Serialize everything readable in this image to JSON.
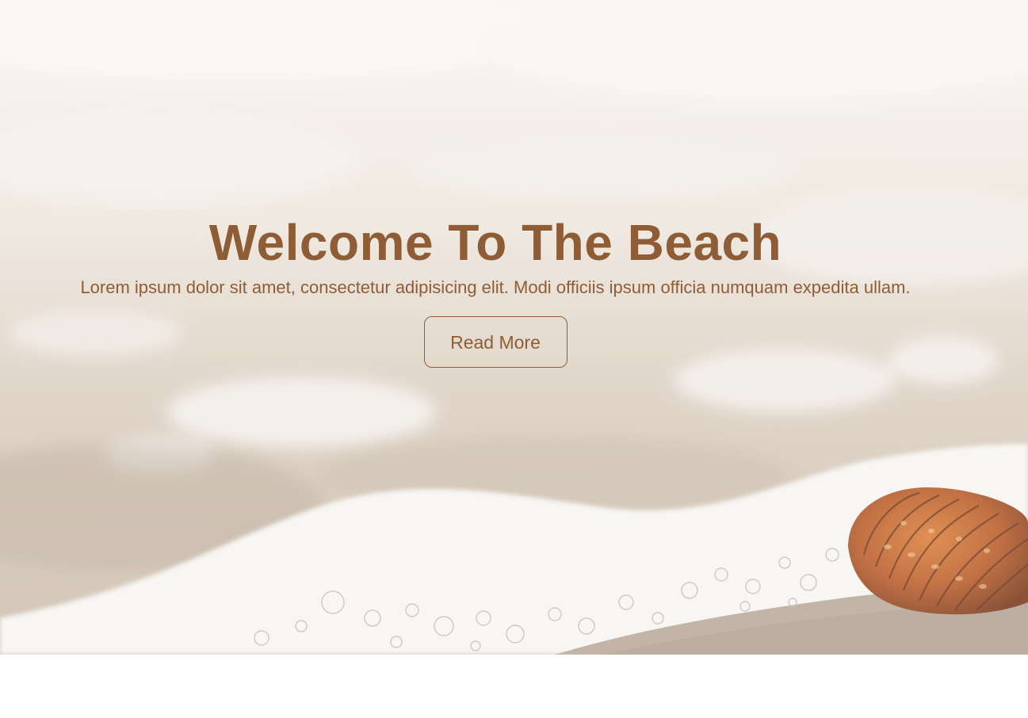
{
  "hero": {
    "title": "Welcome To The Beach",
    "subtitle": "Lorem ipsum dolor sit amet, consectetur adipisicing elit. Modi officiis ipsum officia numquam expedita ullam.",
    "button_label": "Read More",
    "background_image": "beach-shell-foam-photo"
  },
  "colors": {
    "accent": "#8f5d35",
    "sand": "#cdbfad",
    "foam": "#f5f2ee",
    "shell": "#b8531c"
  }
}
